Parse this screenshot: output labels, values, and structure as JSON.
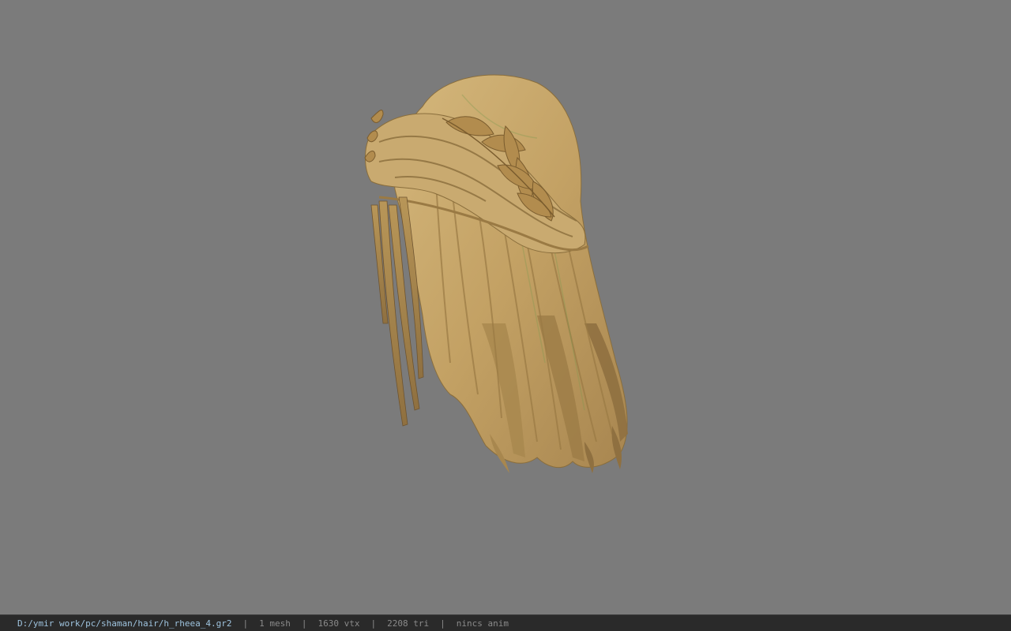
{
  "statusbar": {
    "file_path": "D:/ymir work/pc/shaman/hair/h_rheea_4.gr2",
    "separator": "|",
    "mesh_count": "1 mesh",
    "vertex_count": "1630 vtx",
    "triangle_count": "2208 tri",
    "animation": "nincs anim"
  },
  "colors": {
    "viewport_background": "#7b7b7b",
    "statusbar_background": "#2a2a2a",
    "path_text": "#9ec3de",
    "status_text": "#8a8a8a",
    "hair_base": "#c4a46a",
    "hair_shadow": "#8a6e3c",
    "laurel": "#b08a4c"
  },
  "viewport": {
    "model_icon": "hair-mesh-icon"
  }
}
